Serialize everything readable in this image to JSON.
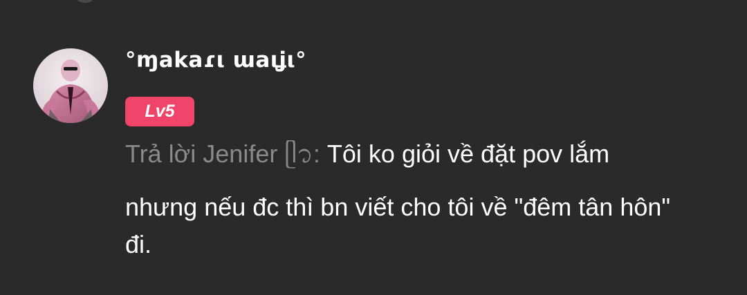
{
  "comment": {
    "username": "°ɱakaɾι ɯaιʝι°",
    "level_badge": "Lv5",
    "reply_prefix": "Trả lời Jenifer ᥫ᭡:",
    "reply_text": " Tôi ko giỏi về đặt pov lắm",
    "message": "nhưng nếu đc thì bn viết cho tôi về \"đêm tân hôn\" đi.",
    "avatar_icon": "profile-avatar-icon",
    "colors": {
      "background": "#2a2a2a",
      "badge": "#f0446a",
      "muted_text": "#8a8a8a",
      "text": "#ffffff"
    }
  }
}
